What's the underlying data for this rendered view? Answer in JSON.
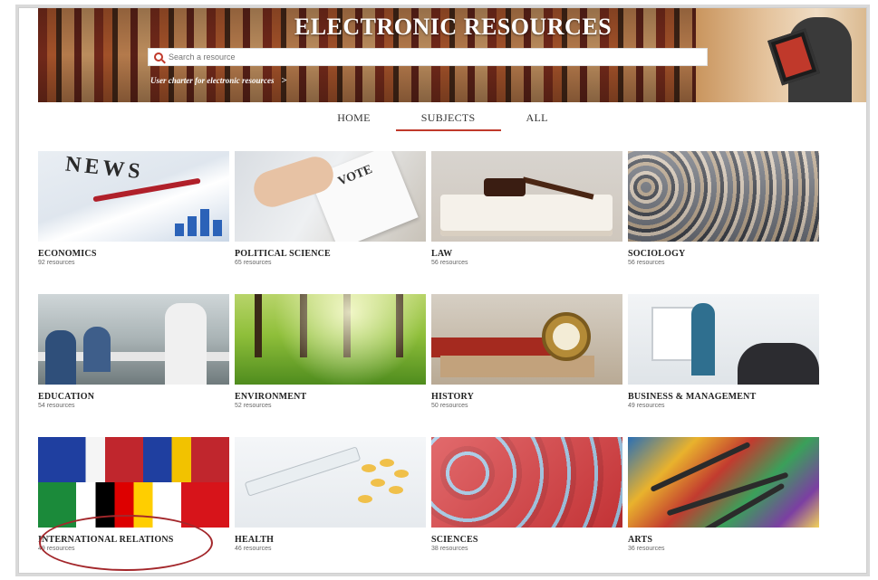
{
  "banner": {
    "title": "ELECTRONIC RESOURCES",
    "search_placeholder": "Search a resource",
    "charter_link": "User charter for electronic resources",
    "charter_chevron": ">"
  },
  "nav": {
    "items": [
      {
        "label": "HOME",
        "active": false
      },
      {
        "label": "SUBJECTS",
        "active": true
      },
      {
        "label": "ALL",
        "active": false
      }
    ]
  },
  "subjects": [
    {
      "title": "ECONOMICS",
      "count": "92 resources"
    },
    {
      "title": "POLITICAL SCIENCE",
      "count": "65 resources"
    },
    {
      "title": "LAW",
      "count": "56 resources"
    },
    {
      "title": "SOCIOLOGY",
      "count": "56 resources"
    },
    {
      "title": "EDUCATION",
      "count": "54 resources"
    },
    {
      "title": "ENVIRONMENT",
      "count": "52 resources"
    },
    {
      "title": "HISTORY",
      "count": "50 resources"
    },
    {
      "title": "BUSINESS & MANAGEMENT",
      "count": "49 resources"
    },
    {
      "title": "INTERNATIONAL RELATIONS",
      "count": "49 resources"
    },
    {
      "title": "HEALTH",
      "count": "46 resources"
    },
    {
      "title": "SCIENCES",
      "count": "38 resources"
    },
    {
      "title": "ARTS",
      "count": "36 resources"
    }
  ],
  "colors": {
    "accent": "#c0392b",
    "annotation": "#a3272b"
  }
}
